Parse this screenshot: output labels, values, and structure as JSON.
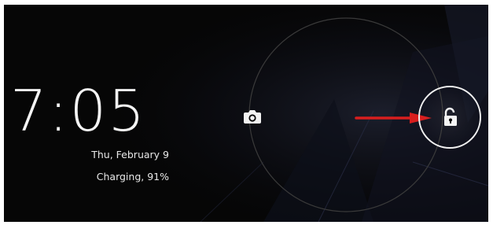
{
  "lockscreen": {
    "time": "7:05",
    "date": "Thu, February 9",
    "battery_status": "Charging, 91%"
  },
  "targets": {
    "camera_icon": "camera-icon",
    "unlock_icon": "unlock-icon"
  },
  "annotation": {
    "arrow_color": "#d81e1e"
  },
  "colors": {
    "background": "#060606",
    "text": "#f4f4f4",
    "ring": "#3a3a3a"
  }
}
